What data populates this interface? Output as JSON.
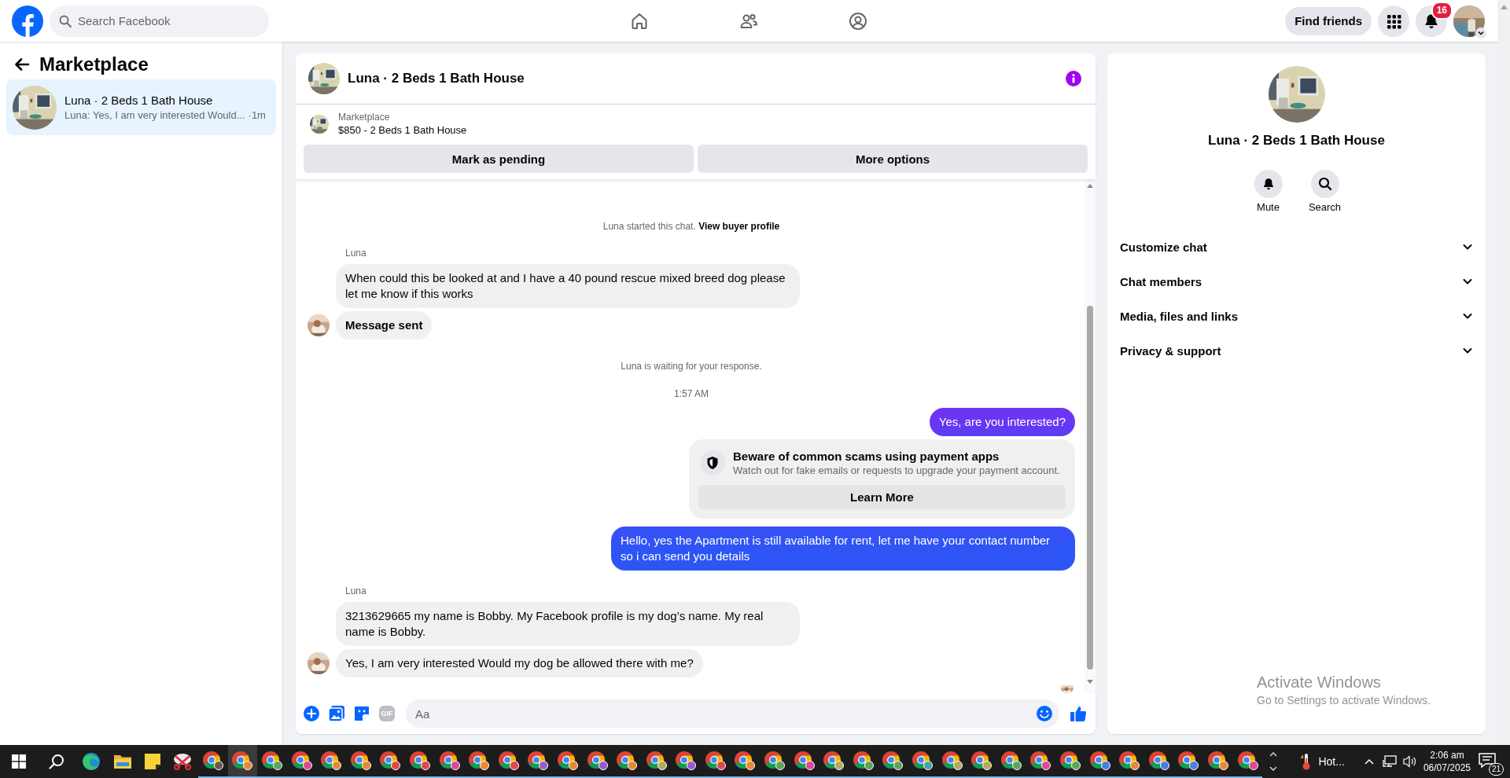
{
  "topbar": {
    "search": {
      "placeholder": "Search Facebook"
    },
    "find_friends": "Find friends",
    "notification_count": "16"
  },
  "sidebar": {
    "title": "Marketplace",
    "conversations": [
      {
        "title": "Luna · 2 Beds 1 Bath House",
        "preview": "Luna: Yes, I am very interested Would...",
        "time": "·1m",
        "selected": true
      }
    ]
  },
  "chat": {
    "title": "Luna · 2 Beds 1 Bath House",
    "listing": {
      "label": "Marketplace",
      "title": "$850 - 2 Beds 1 Bath House"
    },
    "actions": [
      "Mark as pending",
      "More options"
    ],
    "messages": [
      {
        "kind": "notice",
        "text": "Luna started this chat.",
        "link": "View buyer profile"
      },
      {
        "kind": "sender",
        "text": "Luna"
      },
      {
        "kind": "incoming",
        "text": "When could this be looked at and I have a 40 pound rescue mixed breed dog please let me know if this works",
        "avatar": false
      },
      {
        "kind": "status",
        "text": "Message sent",
        "avatar": true
      },
      {
        "kind": "notice",
        "text": "Luna is waiting for your response."
      },
      {
        "kind": "timestamp",
        "text": "1:57 AM"
      },
      {
        "kind": "outgoing",
        "text": "Yes, are you interested?"
      },
      {
        "kind": "alert",
        "title": "Beware of common scams using payment apps",
        "text": "Watch out for fake emails or requests to upgrade your payment account.",
        "button": "Learn More"
      },
      {
        "kind": "outgoing",
        "text": "Hello, yes the Apartment is still available for rent, let me have your contact number so i can send you details"
      },
      {
        "kind": "sender",
        "text": "Luna"
      },
      {
        "kind": "incoming",
        "text": "3213629665 my name is Bobby. My Facebook profile is my dog’s name. My real name is Bobby.",
        "avatar": false
      },
      {
        "kind": "incoming",
        "text": "Yes, I am very interested Would my dog be allowed there with me?",
        "avatar": true
      },
      {
        "kind": "seen"
      }
    ],
    "composer": {
      "gif": "GIF",
      "placeholder": "Aa"
    }
  },
  "details": {
    "title": "Luna · 2 Beds 1 Bath House",
    "actions": [
      {
        "kind": "mute",
        "label": "Mute"
      },
      {
        "kind": "search",
        "label": "Search"
      }
    ],
    "sections": [
      {
        "label": "Customize chat",
        "expanded": false
      },
      {
        "label": "Chat members",
        "expanded": false
      },
      {
        "label": "Media, files and links",
        "expanded": false
      },
      {
        "label": "Privacy & support",
        "expanded": false
      }
    ]
  },
  "os_notice": {
    "title": "Activate Windows",
    "text": "Go to Settings to activate Windows."
  },
  "taskbar": {
    "apps": [
      {
        "kind": "start",
        "selected": false
      },
      {
        "kind": "search",
        "selected": false
      },
      {
        "kind": "edge",
        "selected": false
      },
      {
        "kind": "explorer",
        "selected": false
      },
      {
        "kind": "notes",
        "selected": false
      },
      {
        "kind": "snip",
        "selected": false
      },
      {
        "kind": "chrome",
        "color": "#6b5a4a",
        "selected": false
      },
      {
        "kind": "chrome",
        "color": "#e8873a",
        "selected": true
      },
      {
        "kind": "chrome",
        "color": "#5aa55a",
        "selected": false
      },
      {
        "kind": "chrome",
        "color": "#e0479a",
        "selected": false
      },
      {
        "kind": "chrome",
        "color": "#e8873a",
        "selected": false
      },
      {
        "kind": "chrome",
        "color": "#e8873a",
        "selected": false
      },
      {
        "kind": "chrome",
        "color": "#e04848",
        "selected": false
      },
      {
        "kind": "chrome",
        "color": "#e04848",
        "selected": false
      },
      {
        "kind": "chrome",
        "color": "#e0479a",
        "selected": false
      },
      {
        "kind": "chrome",
        "color": "#e8873a",
        "selected": false
      },
      {
        "kind": "chrome",
        "color": "#e04848",
        "selected": false
      },
      {
        "kind": "chrome",
        "color": "#9b59d0",
        "selected": false
      },
      {
        "kind": "chrome",
        "color": "#e8873a",
        "selected": false
      },
      {
        "kind": "chrome",
        "color": "#9b59d0",
        "selected": false
      },
      {
        "kind": "chrome",
        "color": "#e8873a",
        "selected": false
      },
      {
        "kind": "chrome",
        "color": "#b7a95a",
        "selected": false
      },
      {
        "kind": "chrome",
        "color": "#9b59d0",
        "selected": false
      },
      {
        "kind": "chrome",
        "color": "#e04848",
        "selected": false
      },
      {
        "kind": "chrome",
        "color": "#e8873a",
        "selected": false
      },
      {
        "kind": "chrome",
        "color": "#5aa55a",
        "selected": false
      },
      {
        "kind": "chrome",
        "color": "#e0479a",
        "selected": false
      },
      {
        "kind": "chrome",
        "color": "#b7a95a",
        "selected": false
      },
      {
        "kind": "chrome",
        "color": "#5aa55a",
        "selected": false
      },
      {
        "kind": "chrome",
        "color": "#5aa55a",
        "selected": false
      },
      {
        "kind": "chrome",
        "color": "#45a6a0",
        "selected": false
      },
      {
        "kind": "chrome",
        "color": "#b7a95a",
        "selected": false
      },
      {
        "kind": "chrome",
        "color": "#b7a95a",
        "selected": false
      },
      {
        "kind": "chrome",
        "color": "#5aa55a",
        "selected": false
      },
      {
        "kind": "chrome",
        "color": "#e0479a",
        "selected": false
      },
      {
        "kind": "chrome",
        "color": "#5aa55a",
        "selected": false
      },
      {
        "kind": "chrome",
        "color": "#4a7fe0",
        "selected": false
      },
      {
        "kind": "chrome",
        "color": "#e8873a",
        "selected": false
      },
      {
        "kind": "chrome",
        "color": "#4a7fe0",
        "selected": false
      },
      {
        "kind": "chrome",
        "color": "#4a7fe0",
        "selected": false
      },
      {
        "kind": "chrome",
        "color": "#e8873a",
        "selected": false
      },
      {
        "kind": "chrome",
        "color": "#e0479a",
        "selected": false
      }
    ],
    "weather": "Hot...",
    "time": "2:06 am",
    "date": "06/07/2025",
    "notification_count": "21"
  }
}
